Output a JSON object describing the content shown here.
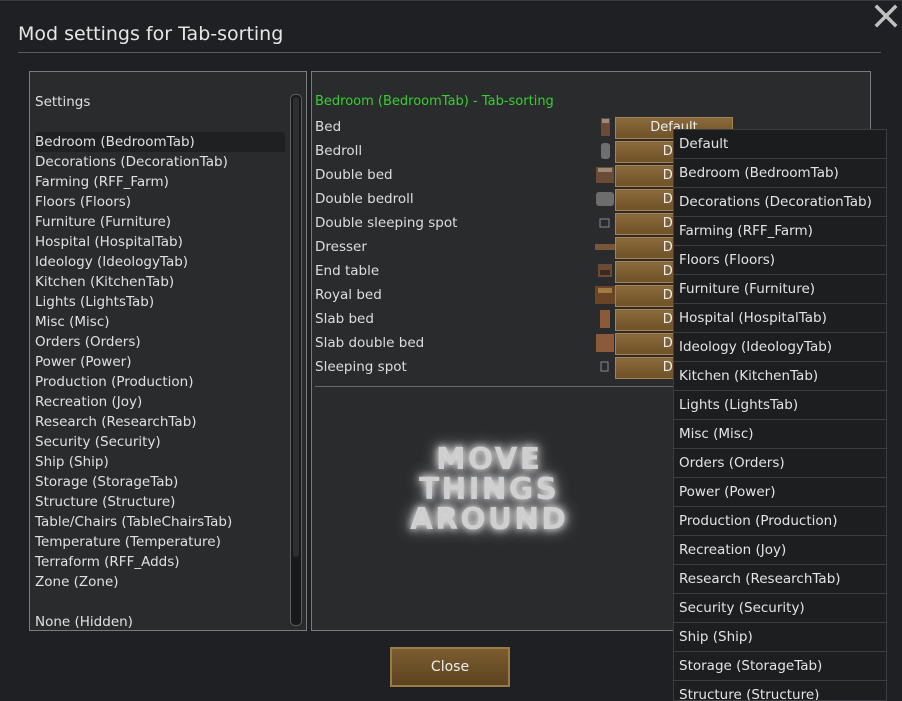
{
  "window": {
    "title": "Mod settings for Tab-sorting"
  },
  "left_panel": {
    "header": "Settings",
    "items": [
      "Bedroom (BedroomTab)",
      "Decorations (DecorationTab)",
      "Farming (RFF_Farm)",
      "Floors (Floors)",
      "Furniture (Furniture)",
      "Hospital (HospitalTab)",
      "Ideology (IdeologyTab)",
      "Kitchen (KitchenTab)",
      "Lights (LightsTab)",
      "Misc (Misc)",
      "Orders (Orders)",
      "Power (Power)",
      "Production (Production)",
      "Recreation (Joy)",
      "Research (ResearchTab)",
      "Security (Security)",
      "Ship (Ship)",
      "Storage (StorageTab)",
      "Structure (Structure)",
      "Table/Chairs (TableChairsTab)",
      "Temperature (Temperature)",
      "Terraform (RFF_Adds)",
      "Zone (Zone)"
    ],
    "selected": "Bedroom (BedroomTab)",
    "footer_item": "None (Hidden)"
  },
  "right_panel": {
    "heading": "Bedroom (BedroomTab) - Tab-sorting",
    "heading_color": "#35d02f",
    "rows": [
      {
        "label": "Bed",
        "value": "Default"
      },
      {
        "label": "Bedroll",
        "value": "Def"
      },
      {
        "label": "Double bed",
        "value": "Def"
      },
      {
        "label": "Double bedroll",
        "value": "Def"
      },
      {
        "label": "Double sleeping spot",
        "value": "Def"
      },
      {
        "label": "Dresser",
        "value": "Def"
      },
      {
        "label": "End table",
        "value": "Def"
      },
      {
        "label": "Royal bed",
        "value": "Def"
      },
      {
        "label": "Slab bed",
        "value": "Def"
      },
      {
        "label": "Slab double bed",
        "value": "Def"
      },
      {
        "label": "Sleeping spot",
        "value": "Def"
      }
    ],
    "logo_line1": "MOVE THINGS",
    "logo_line2": "AROUND"
  },
  "dropdown": {
    "options": [
      "Default",
      "Bedroom (BedroomTab)",
      "Decorations (DecorationTab)",
      "Farming (RFF_Farm)",
      "Floors (Floors)",
      "Furniture (Furniture)",
      "Hospital (HospitalTab)",
      "Ideology (IdeologyTab)",
      "Kitchen (KitchenTab)",
      "Lights (LightsTab)",
      "Misc (Misc)",
      "Orders (Orders)",
      "Power (Power)",
      "Production (Production)",
      "Recreation (Joy)",
      "Research (ResearchTab)",
      "Security (Security)",
      "Ship (Ship)",
      "Storage (StorageTab)",
      "Structure (Structure)"
    ]
  },
  "footer": {
    "close_label": "Close"
  },
  "colors": {
    "button": "#7a5c2f",
    "accent_green": "#35d02f"
  }
}
